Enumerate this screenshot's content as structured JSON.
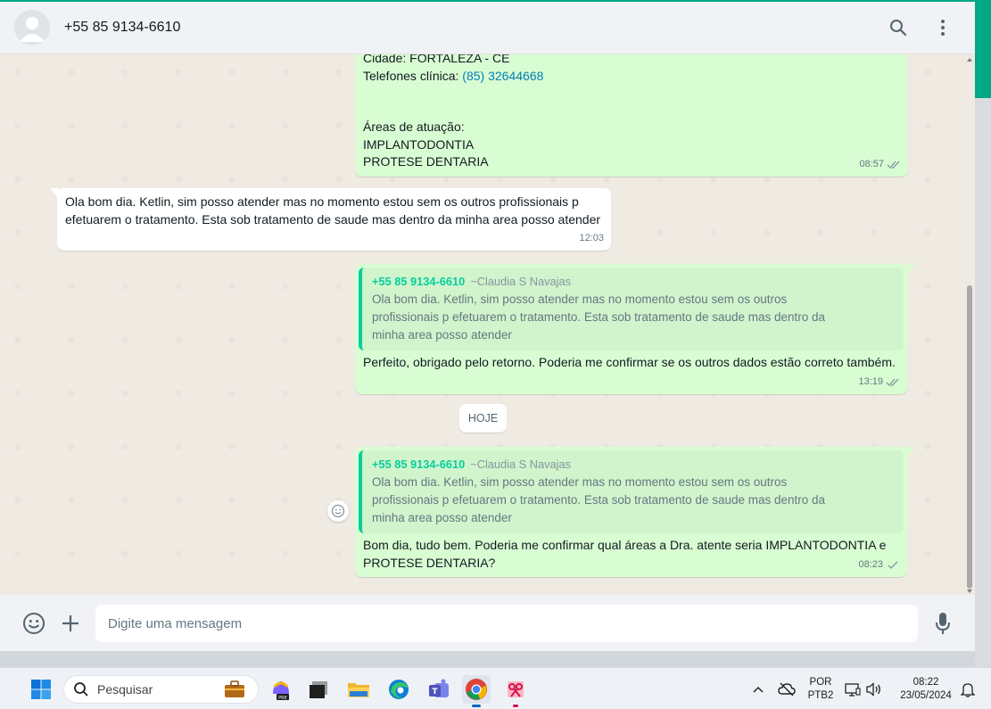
{
  "header": {
    "contact_name": "+55 85 9134-6610",
    "icons": [
      "search-icon",
      "menu-icon"
    ]
  },
  "messages": {
    "m1": {
      "line1": "Cidade: FORTALEZA - CE",
      "phone_label": "Telefones clínica: ",
      "phone_value": "(85) 32644668",
      "areas_title": "Áreas de atuação:",
      "area1": "IMPLANTODONTIA",
      "area2": "PROTESE DENTARIA",
      "time": "08:57"
    },
    "m2": {
      "text": "Ola bom dia. Ketlin, sim posso atender mas no momento estou sem os outros profissionais p efetuarem o tratamento. Esta sob tratamento de saude mas dentro da minha area posso atender",
      "time": "12:03"
    },
    "m3": {
      "quote_author": "+55 85 9134-6610",
      "quote_alias": "~Claudia S Navajas",
      "quote_text": "Ola bom dia. Ketlin, sim posso atender mas no momento estou sem os outros profissionais p efetuarem o tratamento. Esta sob tratamento de saude mas dentro da minha area posso atender",
      "text": "Perfeito, obrigado pelo retorno. Poderia me confirmar se os outros dados estão correto também.",
      "time": "13:19"
    },
    "date_chip": "HOJE",
    "m4": {
      "quote_author": "+55 85 9134-6610",
      "quote_alias": "~Claudia S Navajas",
      "quote_text": "Ola bom dia. Ketlin, sim posso atender mas no momento estou sem os outros profissionais p efetuarem o tratamento. Esta sob tratamento de saude mas dentro da minha area posso atender",
      "text": "Bom dia, tudo bem. Poderia me confirmar qual áreas a Dra. atente seria IMPLANTODONTIA  e PROTESE DENTARIA?",
      "time": "08:23"
    }
  },
  "footer": {
    "input_placeholder": "Digite uma mensagem",
    "icons": [
      "emoji-icon",
      "plus-icon",
      "mic-icon"
    ]
  },
  "taskbar": {
    "search_placeholder": "Pesquisar",
    "lang_line1": "POR",
    "lang_line2": "PTB2",
    "clock_time": "08:22",
    "clock_date": "23/05/2024",
    "apps": [
      "windows-start-icon",
      "briefcase-icon",
      "copilot-icon",
      "terminal-icon",
      "file-explorer-icon",
      "edge-icon",
      "teams-icon",
      "chrome-icon",
      "snipping-tool-icon"
    ]
  },
  "colors": {
    "accent": "#00a884",
    "outgoing_bubble": "#d9fdd3",
    "quote_border": "#06cf9c",
    "link": "#027eb5"
  }
}
